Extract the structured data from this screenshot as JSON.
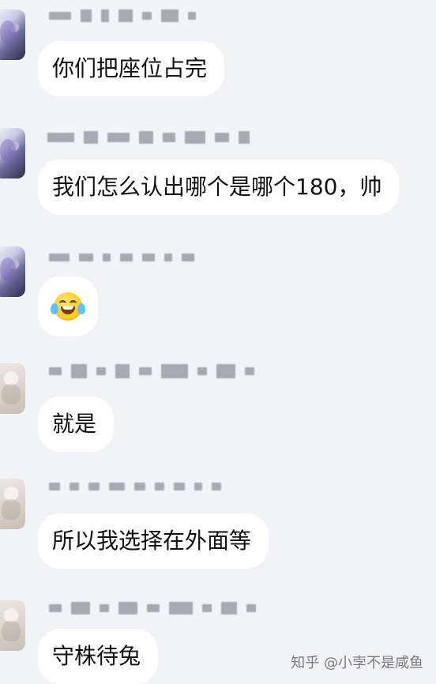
{
  "messages": [
    {
      "avatar": "avatar-purple-anime",
      "text": "你们把座位占完"
    },
    {
      "avatar": "avatar-purple-anime",
      "text": "我们怎么认出哪个是哪个180，帅"
    },
    {
      "avatar": "avatar-purple-anime",
      "emoji": "tears-of-joy-icon"
    },
    {
      "avatar": "avatar-light-anime",
      "text": "就是"
    },
    {
      "avatar": "avatar-light-anime",
      "text": "所以我选择在外面等"
    },
    {
      "avatar": "avatar-light-anime",
      "text": "守株待兔"
    }
  ],
  "watermark": {
    "text": "知乎 @小孛不是咸鱼"
  },
  "colors": {
    "background": "#f2f3f7",
    "bubble": "#ffffff",
    "text": "#111111",
    "watermark": "#7a7a80"
  }
}
